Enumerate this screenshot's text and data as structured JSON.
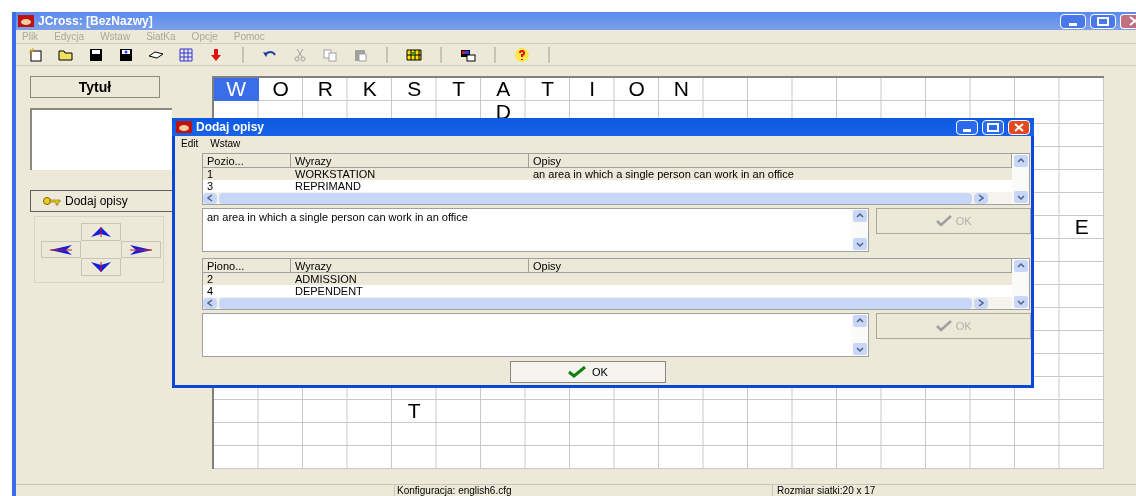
{
  "window": {
    "title": "JCross: [BezNazwy]"
  },
  "menu": [
    {
      "label": "Plik",
      "disabled": true
    },
    {
      "label": "Edycja",
      "disabled": true
    },
    {
      "label": "Wstaw",
      "disabled": true
    },
    {
      "label": "SiatKa",
      "disabled": true
    },
    {
      "label": "Opcje",
      "disabled": true
    },
    {
      "label": "Pomoc",
      "disabled": true
    }
  ],
  "toolbar": [
    {
      "kind": "new"
    },
    {
      "kind": "open"
    },
    {
      "kind": "save"
    },
    {
      "kind": "saveas"
    },
    {
      "kind": "eraser"
    },
    {
      "kind": "pattern"
    },
    {
      "kind": "down"
    },
    {
      "kind": "sep"
    },
    {
      "kind": "undo"
    },
    {
      "kind": "cut",
      "disabled": true
    },
    {
      "kind": "copy",
      "disabled": true
    },
    {
      "kind": "paste",
      "disabled": true
    },
    {
      "kind": "sep"
    },
    {
      "kind": "grid"
    },
    {
      "kind": "sep"
    },
    {
      "kind": "display"
    },
    {
      "kind": "sep"
    },
    {
      "kind": "help"
    },
    {
      "kind": "sep"
    }
  ],
  "left_panel": {
    "title_button": "Tytuł",
    "add_button": "Dodaj opisy"
  },
  "grid": {
    "rows": [
      [
        {
          "letter": "W",
          "selected": true
        },
        {
          "letter": "O",
          "selected": false
        },
        {
          "letter": "R",
          "selected": false
        },
        {
          "letter": "K",
          "selected": false
        },
        {
          "letter": "S",
          "selected": false
        },
        {
          "letter": "T",
          "selected": false
        },
        {
          "letter": "A",
          "selected": false
        },
        {
          "letter": "T",
          "selected": false
        },
        {
          "letter": "I",
          "selected": false
        },
        {
          "letter": "O",
          "selected": false
        },
        {
          "letter": "N",
          "selected": false
        },
        null,
        null,
        null,
        null,
        null,
        null,
        null,
        null,
        null
      ],
      [
        null,
        null,
        null,
        null,
        null,
        null,
        {
          "letter": "D",
          "selected": false
        },
        null,
        null,
        null,
        null,
        null,
        null,
        null,
        null,
        null,
        null,
        null,
        null,
        null
      ],
      [
        null,
        null,
        null,
        null,
        null,
        null,
        null,
        null,
        null,
        null,
        null,
        null,
        null,
        null,
        null,
        null,
        null,
        null,
        null,
        null
      ],
      [
        null,
        null,
        null,
        null,
        null,
        null,
        null,
        null,
        null,
        null,
        null,
        null,
        null,
        null,
        null,
        null,
        null,
        null,
        null,
        null
      ],
      [
        null,
        null,
        null,
        null,
        null,
        null,
        null,
        null,
        null,
        null,
        null,
        null,
        null,
        null,
        null,
        null,
        null,
        null,
        null,
        null
      ],
      [
        null,
        null,
        null,
        null,
        null,
        null,
        null,
        null,
        null,
        null,
        null,
        null,
        null,
        null,
        null,
        null,
        null,
        null,
        null,
        null
      ],
      [
        null,
        null,
        null,
        null,
        null,
        null,
        null,
        null,
        null,
        null,
        null,
        null,
        null,
        null,
        null,
        null,
        null,
        null,
        null,
        {
          "letter": "E",
          "selected": false
        }
      ],
      [
        null,
        null,
        null,
        null,
        null,
        null,
        null,
        null,
        null,
        null,
        null,
        null,
        null,
        null,
        null,
        null,
        null,
        null,
        null,
        null
      ],
      [
        null,
        null,
        null,
        null,
        null,
        null,
        null,
        null,
        null,
        null,
        null,
        null,
        null,
        null,
        null,
        null,
        null,
        null,
        null,
        null
      ],
      [
        null,
        null,
        null,
        null,
        null,
        null,
        null,
        null,
        null,
        null,
        null,
        null,
        null,
        null,
        null,
        null,
        null,
        null,
        null,
        null
      ],
      [
        null,
        null,
        null,
        null,
        null,
        null,
        null,
        null,
        null,
        null,
        null,
        null,
        null,
        null,
        null,
        null,
        null,
        null,
        null,
        null
      ],
      [
        null,
        null,
        null,
        null,
        null,
        null,
        null,
        null,
        null,
        null,
        null,
        null,
        null,
        null,
        null,
        null,
        null,
        null,
        null,
        null
      ],
      [
        null,
        null,
        null,
        null,
        null,
        null,
        null,
        null,
        null,
        null,
        null,
        null,
        null,
        null,
        null,
        null,
        null,
        null,
        null,
        null
      ],
      [
        null,
        null,
        null,
        null,
        null,
        null,
        null,
        null,
        null,
        null,
        null,
        null,
        null,
        null,
        null,
        null,
        null,
        null,
        null,
        null
      ],
      [
        null,
        null,
        null,
        null,
        {
          "letter": "T",
          "selected": false
        },
        null,
        null,
        null,
        null,
        null,
        null,
        null,
        null,
        null,
        null,
        null,
        null,
        null,
        null,
        null
      ],
      [
        null,
        null,
        null,
        null,
        null,
        null,
        null,
        null,
        null,
        null,
        null,
        null,
        null,
        null,
        null,
        null,
        null,
        null,
        null,
        null
      ],
      [
        null,
        null,
        null,
        null,
        null,
        null,
        null,
        null,
        null,
        null,
        null,
        null,
        null,
        null,
        null,
        null,
        null,
        null,
        null,
        null
      ]
    ]
  },
  "dialog": {
    "title": "Dodaj opisy",
    "menu": [
      "Edit",
      "Wstaw"
    ],
    "sections": [
      {
        "columns": [
          "Pozio...",
          "Wyrazy",
          "Opisy"
        ],
        "rows": [
          {
            "cells": [
              "1",
              "WORKSTATION",
              "an area in which a single person can work in an office"
            ],
            "selected": true
          },
          {
            "cells": [
              "3",
              "REPRIMAND"
            ],
            "selected": false
          }
        ],
        "description": "an area in which a single person can work in an office",
        "ok": {
          "label": "OK",
          "disabled": true
        }
      },
      {
        "columns": [
          "Piono...",
          "Wyrazy",
          "Opisy"
        ],
        "rows": [
          {
            "cells": [
              "2",
              "ADMISSION"
            ],
            "selected": true
          },
          {
            "cells": [
              "4",
              "DEPENDENT"
            ],
            "selected": false
          }
        ],
        "ok": {
          "label": "OK",
          "disabled": true
        }
      }
    ],
    "ok_button": "OK"
  },
  "status_bar": {
    "config": "Konfiguracja: english6.cfg",
    "grid_size": "Rozmiar siatki:20 x 17"
  }
}
